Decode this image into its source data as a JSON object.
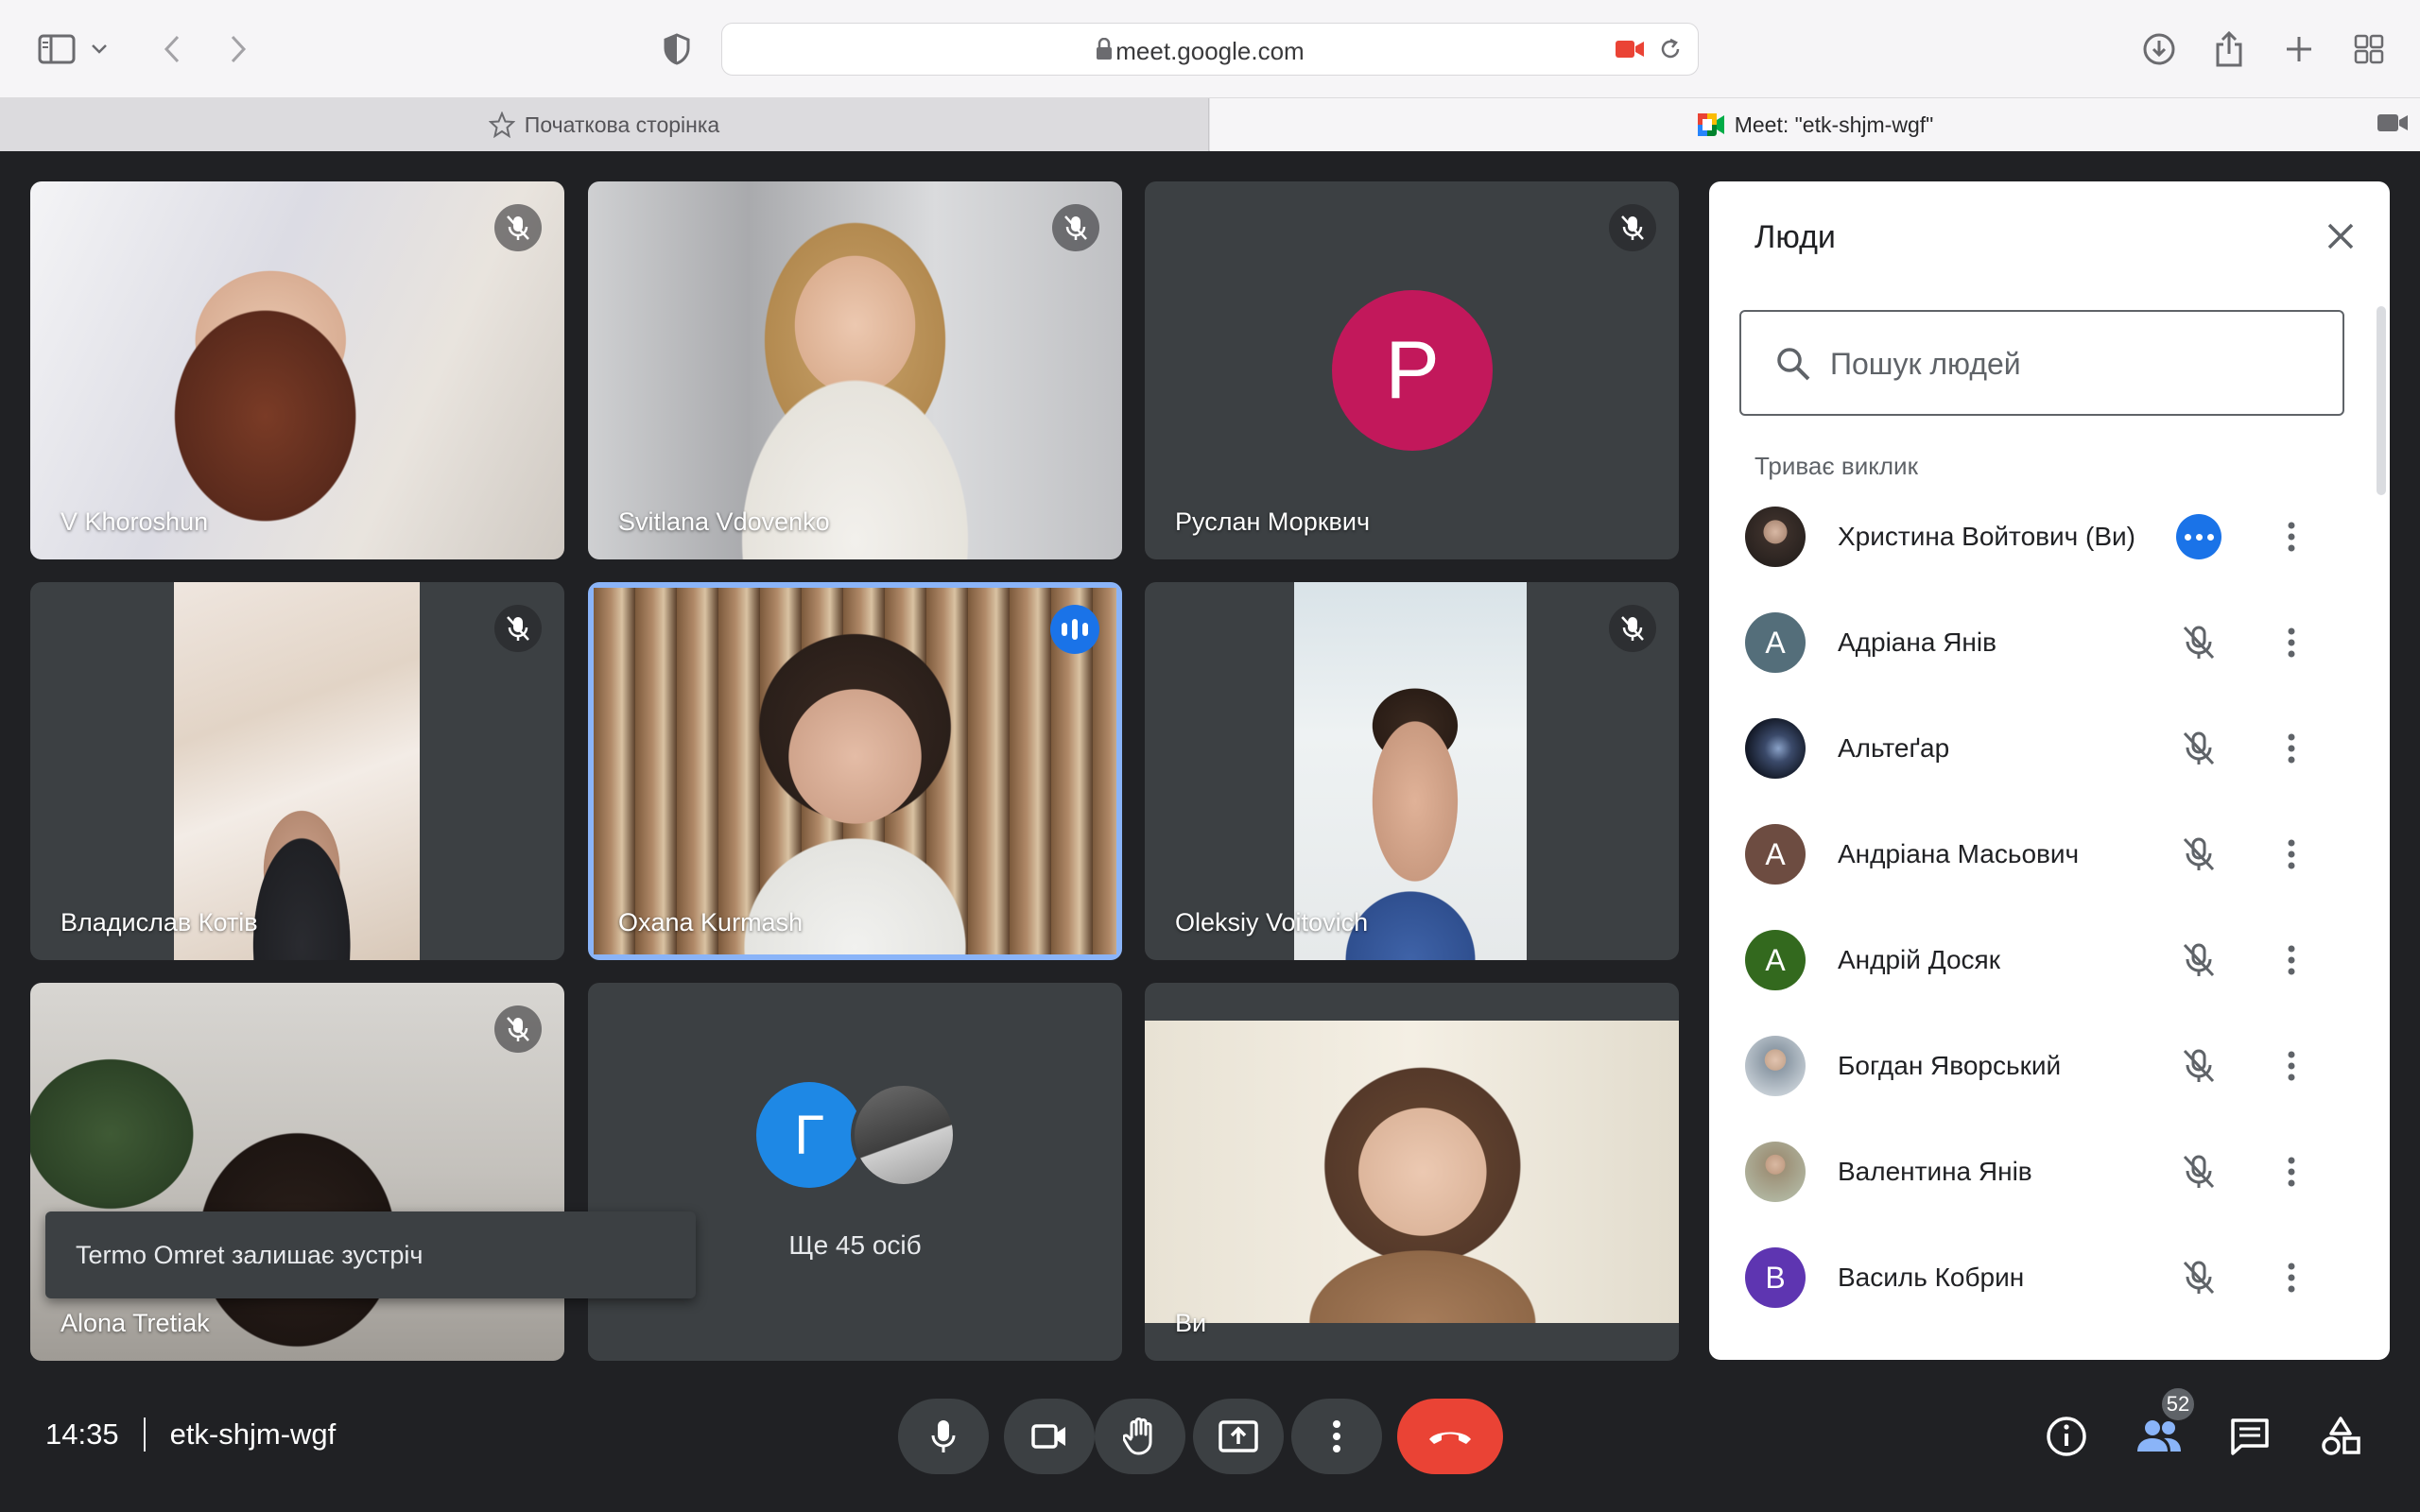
{
  "browser": {
    "url": "meet.google.com",
    "tabs": [
      {
        "label": "Початкова сторінка",
        "active": false
      },
      {
        "label": "Meet: \"etk-shjm-wgf\"",
        "active": true
      }
    ]
  },
  "tiles": [
    {
      "name": "V Khoroshun",
      "muted": true
    },
    {
      "name": "Svitlana Vdovenko",
      "muted": true
    },
    {
      "name": "Руслан Морквич",
      "muted": true,
      "avatar_letter": "P",
      "avatar_color": "#c2185b"
    },
    {
      "name": "Владислав Котів",
      "muted": true
    },
    {
      "name": "Oxana Kurmash",
      "muted": false,
      "speaking": true
    },
    {
      "name": "Oleksiy Voitovich",
      "muted": true
    },
    {
      "name": "Alona Tretiak",
      "muted": true
    },
    {
      "more_letter": "Г",
      "more_label": "Ще 45 осіб"
    },
    {
      "name": "Ви",
      "muted": false
    }
  ],
  "toast": {
    "text": "Termo Omret залишає зустріч"
  },
  "people_panel": {
    "title": "Люди",
    "search_placeholder": "Пошук людей",
    "section": "Триває виклик",
    "people": [
      {
        "name": "Христина Войтович (Ви)",
        "avatar": "",
        "color": "#3a3a3a",
        "state": "active"
      },
      {
        "name": "Адріана Янів",
        "avatar": "A",
        "color": "#546e7a",
        "state": "muted"
      },
      {
        "name": "Альтеґар",
        "avatar": "",
        "color": "#1c2333",
        "state": "muted"
      },
      {
        "name": "Андріана Масьович",
        "avatar": "A",
        "color": "#6d4c41",
        "state": "muted"
      },
      {
        "name": "Андрій Досяк",
        "avatar": "A",
        "color": "#33691e",
        "state": "muted"
      },
      {
        "name": "Богдан Яворський",
        "avatar": "",
        "color": "#8d9aa6",
        "state": "muted"
      },
      {
        "name": "Валентина Янів",
        "avatar": "",
        "color": "#9e9279",
        "state": "muted"
      },
      {
        "name": "Василь Кобрин",
        "avatar": "B",
        "color": "#5e35b1",
        "state": "muted"
      }
    ]
  },
  "bottom": {
    "time": "14:35",
    "meeting_code": "etk-shjm-wgf",
    "participants_count": "52"
  }
}
